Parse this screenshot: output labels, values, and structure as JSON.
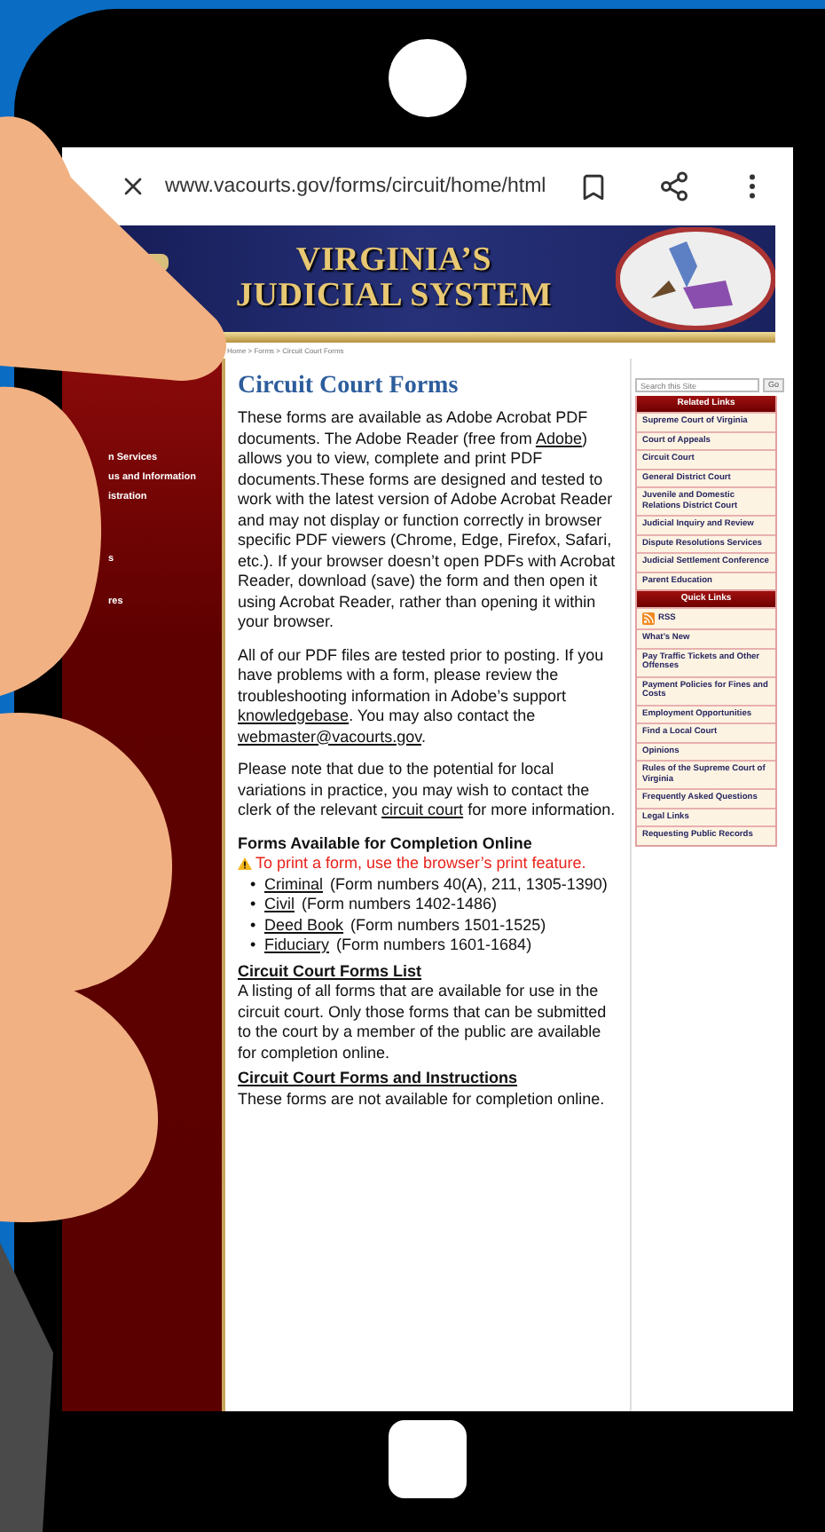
{
  "browser_bar": {
    "url": "www.vacourts.gov/forms/circuit/home/html"
  },
  "banner": {
    "title_lines": [
      "VIRGINIA’S",
      "JUDICIAL SYSTEM"
    ]
  },
  "breadcrumb": "Home > Forms > Circuit Court Forms",
  "left_nav": {
    "items": [
      "n Services",
      "us and Information",
      "istration",
      "s",
      "res"
    ]
  },
  "main": {
    "title": "Circuit Court Forms",
    "paragraphs": [
      [
        {
          "kind": "text",
          "text": "These forms are available as Adobe Acrobat PDF documents. The Adobe Reader (free from "
        },
        {
          "kind": "link",
          "text": "Adobe"
        },
        {
          "kind": "text",
          "text": ") allows you to view, complete and print PDF documents.These forms are designed and tested to work with the latest version of Adobe Acrobat Reader and may not display or function correctly in browser specific PDF viewers (Chrome, Edge, Firefox, Safari, etc.).  If your browser doesn’t open PDFs with Acrobat Reader, download (save) the form and then open it using Acrobat Reader, rather than opening it within your browser."
        }
      ],
      [
        {
          "kind": "text",
          "text": "All of our PDF files are tested prior to posting. If you have problems with a form, please review the troubleshooting information in Adobe’s support "
        },
        {
          "kind": "link",
          "text": "knowledgebase"
        },
        {
          "kind": "text",
          "text": ". You may also contact the "
        },
        {
          "kind": "link",
          "text": "webmaster@vacourts.gov"
        },
        {
          "kind": "text",
          "text": "."
        }
      ],
      [
        {
          "kind": "text",
          "text": "Please note that due to the potential for local variations in practice, you may wish to contact the clerk of the relevant "
        },
        {
          "kind": "link",
          "text": "circuit court"
        },
        {
          "kind": "text",
          "text": " for more information."
        }
      ]
    ],
    "online_forms": {
      "heading": "Forms Available for Completion Online",
      "warning": "To print a form, use the browser’s print feature.",
      "items": [
        {
          "bullet": "•",
          "link": "Criminal",
          "note": "(Form numbers 40(A), 211, 1305-1390)"
        },
        {
          "bullet": "•",
          "link": "Civil",
          "note": "(Form numbers 1402-1486)"
        },
        {
          "bullet": "•",
          "link": "Deed Book",
          "note": "(Form numbers 1501-1525)"
        },
        {
          "bullet": "•",
          "link": "Fiduciary",
          "note": "(Form numbers 1601-1684)"
        }
      ]
    },
    "sections": [
      {
        "heading": "Circuit Court Forms List",
        "text": "A listing of all forms that are available for use in the circuit court. Only those forms that can be submitted to the court by a member of the public are available for completion online."
      },
      {
        "heading": "Circuit Court Forms and Instructions",
        "text": "These forms are not available for completion online."
      }
    ]
  },
  "right_sidebar": {
    "search": {
      "placeholder": "Search this Site"
    },
    "go_button": "Go",
    "groups": [
      {
        "title": "Related Links",
        "items": [
          {
            "kind": "link",
            "label": "Supreme Court of Virginia"
          },
          {
            "kind": "link",
            "label": "Court of Appeals"
          },
          {
            "kind": "link",
            "label": "Circuit Court"
          },
          {
            "kind": "link",
            "label": "General District Court"
          },
          {
            "kind": "link",
            "label": "Juvenile and Domestic Relations District Court"
          },
          {
            "kind": "link",
            "label": "Judicial Inquiry and Review"
          },
          {
            "kind": "link",
            "label": "Dispute Resolutions Services"
          },
          {
            "kind": "link",
            "label": "Judicial Settlement Conference"
          },
          {
            "kind": "link",
            "label": "Parent Education"
          }
        ]
      },
      {
        "title": "Quick Links",
        "items": [
          {
            "kind": "rss",
            "label": "RSS"
          },
          {
            "kind": "link",
            "label": "What’s New"
          },
          {
            "kind": "link",
            "label": "Pay Traffic Tickets and Other Offenses"
          },
          {
            "kind": "link",
            "label": "Payment Policies for Fines and Costs"
          },
          {
            "kind": "link",
            "label": "Employment Opportunities"
          },
          {
            "kind": "link",
            "label": "Find a Local Court"
          },
          {
            "kind": "link",
            "label": "Opinions"
          },
          {
            "kind": "link",
            "label": "Rules of the Supreme Court of Virginia"
          },
          {
            "kind": "link",
            "label": "Frequently Asked Questions"
          },
          {
            "kind": "link",
            "label": "Legal Links"
          },
          {
            "kind": "link",
            "label": "Requesting Public Records"
          }
        ]
      }
    ]
  }
}
